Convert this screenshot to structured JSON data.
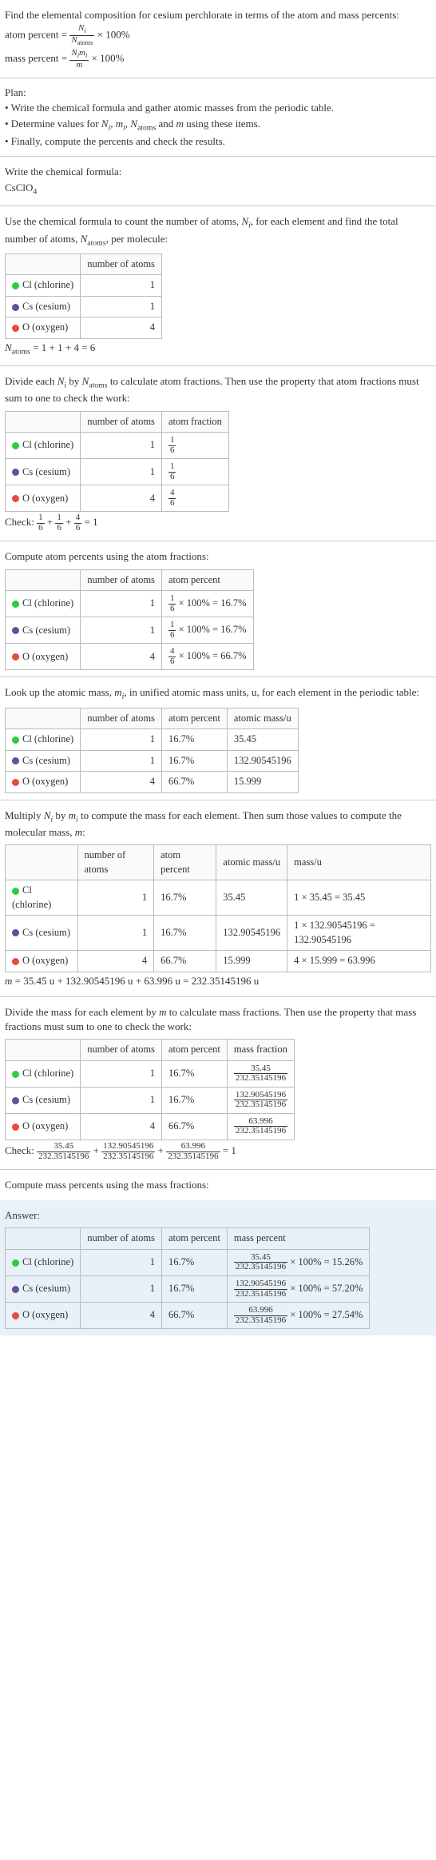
{
  "intro": {
    "line1": "Find the elemental composition for cesium perchlorate in terms of the atom and mass percents:",
    "eq1_lhs": "atom percent =",
    "eq1_rhs": " × 100%",
    "eq1_frac_num": "N_i",
    "eq1_frac_den": "N_atoms",
    "eq2_lhs": "mass percent =",
    "eq2_rhs": " × 100%",
    "eq2_frac_num": "N_i m_i",
    "eq2_frac_den": "m"
  },
  "plan": {
    "head": "Plan:",
    "b1": "• Write the chemical formula and gather atomic masses from the periodic table.",
    "b2_a": "• Determine values for ",
    "b2_b": "N_i, m_i, N_atoms",
    "b2_c": " and ",
    "b2_d": "m",
    "b2_e": " using these items.",
    "b3": "• Finally, compute the percents and check the results."
  },
  "formula_sec": {
    "line": "Write the chemical formula:",
    "formula": "CsClO",
    "sub": "4"
  },
  "count_sec": {
    "line_a": "Use the chemical formula to count the number of atoms, ",
    "line_b": "N_i",
    "line_c": ", for each element and find the total number of atoms, ",
    "line_d": "N_atoms",
    "line_e": ", per molecule:",
    "th1": "number of atoms",
    "r1e": "Cl (chlorine)",
    "r1n": "1",
    "r2e": "Cs (cesium)",
    "r2n": "1",
    "r3e": "O (oxygen)",
    "r3n": "4",
    "total_a": "N_atoms",
    "total_b": " = 1 + 1 + 4 = 6"
  },
  "atomfrac_sec": {
    "line_a": "Divide each ",
    "line_b": "N_i",
    "line_c": " by ",
    "line_d": "N_atoms",
    "line_e": " to calculate atom fractions. Then use the property that atom fractions must sum to one to check the work:",
    "th1": "number of atoms",
    "th2": "atom fraction",
    "r1e": "Cl (chlorine)",
    "r1n": "1",
    "r1f_n": "1",
    "r1f_d": "6",
    "r2e": "Cs (cesium)",
    "r2n": "1",
    "r2f_n": "1",
    "r2f_d": "6",
    "r3e": "O (oxygen)",
    "r3n": "4",
    "r3f_n": "4",
    "r3f_d": "6",
    "check_a": "Check: ",
    "c1n": "1",
    "c1d": "6",
    "plus": " + ",
    "c2n": "1",
    "c2d": "6",
    "c3n": "4",
    "c3d": "6",
    "check_b": " = 1"
  },
  "atompct_sec": {
    "line": "Compute atom percents using the atom fractions:",
    "th1": "number of atoms",
    "th2": "atom percent",
    "r1e": "Cl (chlorine)",
    "r1n": "1",
    "r1f_n": "1",
    "r1f_d": "6",
    "r1p": " × 100% = 16.7%",
    "r2e": "Cs (cesium)",
    "r2n": "1",
    "r2f_n": "1",
    "r2f_d": "6",
    "r2p": " × 100% = 16.7%",
    "r3e": "O (oxygen)",
    "r3n": "4",
    "r3f_n": "4",
    "r3f_d": "6",
    "r3p": " × 100% = 66.7%"
  },
  "atomicmass_sec": {
    "line_a": "Look up the atomic mass, ",
    "line_b": "m_i",
    "line_c": ", in unified atomic mass units, u, for each element in the periodic table:",
    "th1": "number of atoms",
    "th2": "atom percent",
    "th3": "atomic mass/u",
    "r1e": "Cl (chlorine)",
    "r1n": "1",
    "r1p": "16.7%",
    "r1m": "35.45",
    "r2e": "Cs (cesium)",
    "r2n": "1",
    "r2p": "16.7%",
    "r2m": "132.90545196",
    "r3e": "O (oxygen)",
    "r3n": "4",
    "r3p": "66.7%",
    "r3m": "15.999"
  },
  "massmult_sec": {
    "line_a": "Multiply ",
    "line_b": "N_i",
    "line_c": " by ",
    "line_d": "m_i",
    "line_e": " to compute the mass for each element. Then sum those values to compute the molecular mass, ",
    "line_f": "m",
    "line_g": ":",
    "th1": "number of atoms",
    "th2": "atom percent",
    "th3": "atomic mass/u",
    "th4": "mass/u",
    "r1e": "Cl (chlorine)",
    "r1n": "1",
    "r1p": "16.7%",
    "r1m": "35.45",
    "r1x": "1 × 35.45 = 35.45",
    "r2e": "Cs (cesium)",
    "r2n": "1",
    "r2p": "16.7%",
    "r2m": "132.90545196",
    "r2x": "1 × 132.90545196 = 132.90545196",
    "r3e": "O (oxygen)",
    "r3n": "4",
    "r3p": "66.7%",
    "r3m": "15.999",
    "r3x": "4 × 15.999 = 63.996",
    "total_a": "m",
    "total_b": " = 35.45 u + 132.90545196 u + 63.996 u = 232.35145196 u"
  },
  "massfrac_sec": {
    "line_a": "Divide the mass for each element by ",
    "line_b": "m",
    "line_c": " to calculate mass fractions. Then use the property that mass fractions must sum to one to check the work:",
    "th1": "number of atoms",
    "th2": "atom percent",
    "th3": "mass fraction",
    "r1e": "Cl (chlorine)",
    "r1n": "1",
    "r1p": "16.7%",
    "r1f_n": "35.45",
    "r1f_d": "232.35145196",
    "r2e": "Cs (cesium)",
    "r2n": "1",
    "r2p": "16.7%",
    "r2f_n": "132.90545196",
    "r2f_d": "232.35145196",
    "r3e": "O (oxygen)",
    "r3n": "4",
    "r3p": "66.7%",
    "r3f_n": "63.996",
    "r3f_d": "232.35145196",
    "check_a": "Check: ",
    "c1n": "35.45",
    "c1d": "232.35145196",
    "plus": " + ",
    "c2n": "132.90545196",
    "c2d": "232.35145196",
    "c3n": "63.996",
    "c3d": "232.35145196",
    "check_b": " = 1"
  },
  "masspct_sec": {
    "line": "Compute mass percents using the mass fractions:"
  },
  "answer": {
    "label": "Answer:",
    "th1": "number of atoms",
    "th2": "atom percent",
    "th3": "mass percent",
    "r1e": "Cl (chlorine)",
    "r1n": "1",
    "r1p": "16.7%",
    "r1f_n": "35.45",
    "r1f_d": "232.35145196",
    "r1r": " × 100% = 15.26%",
    "r2e": "Cs (cesium)",
    "r2n": "1",
    "r2p": "16.7%",
    "r2f_n": "132.90545196",
    "r2f_d": "232.35145196",
    "r2r": " × 100% = 57.20%",
    "r3e": "O (oxygen)",
    "r3n": "4",
    "r3p": "66.7%",
    "r3f_n": "63.996",
    "r3f_d": "232.35145196",
    "r3r": " × 100% = 27.54%"
  }
}
